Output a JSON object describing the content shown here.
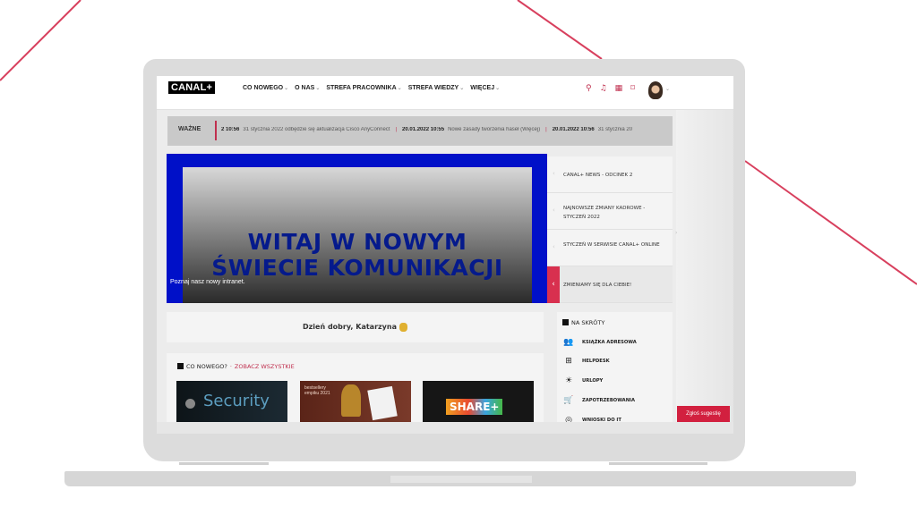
{
  "brand": {
    "logo_text": "CANAL+",
    "accent_color": "#d2203f",
    "hero_blue": "#0010c8"
  },
  "nav": {
    "items": [
      {
        "label": "CO NOWEGO",
        "has_dropdown": true
      },
      {
        "label": "O NAS",
        "has_dropdown": true
      },
      {
        "label": "STREFA PRACOWNIKA",
        "has_dropdown": true
      },
      {
        "label": "STREFA WIEDZY",
        "has_dropdown": true
      },
      {
        "label": "WIĘCEJ",
        "has_dropdown": true
      }
    ],
    "dropdown_glyph": "⌄"
  },
  "top_icons": [
    {
      "name": "search-icon",
      "glyph": "⚲"
    },
    {
      "name": "bell-icon",
      "glyph": "♫"
    },
    {
      "name": "apps-grid-icon",
      "glyph": "▦"
    },
    {
      "name": "bookmark-icon",
      "glyph": "⌑"
    }
  ],
  "user": {
    "avatar": "profile-photo",
    "menu_glyph": "⌄"
  },
  "important": {
    "label": "WAŻNE",
    "ticker": [
      {
        "date": "2 10:56",
        "text": "31 stycznia 2022 odbędzie się aktualizacja Cisco AnyConnect"
      },
      {
        "date": "20.01.2022 10:55",
        "text": "Nowe zasady tworzenia haseł (Więcej)"
      },
      {
        "date": "20.01.2022 10:56",
        "text": "31 stycznia 20"
      }
    ]
  },
  "hero": {
    "title_line1": "WITAJ W NOWYM",
    "title_line2": "ŚWIECIE KOMUNIKACJI",
    "caption": "Poznaj nasz nowy intranet."
  },
  "slider": {
    "items": [
      {
        "label": "CANAL+ NEWS - ODCINEK 2",
        "active": false
      },
      {
        "label": "NAJNOWSZE ZMIANY KADROWE - STYCZEŃ 2022",
        "active": false
      },
      {
        "label": "STYCZEŃ W SERWISIE CANAL+ ONLINE",
        "active": false
      },
      {
        "label": "ZMIENIAMY SIĘ DLA CIEBIE!",
        "active": true
      }
    ],
    "prev_glyph": "‹",
    "next_glyph": "›"
  },
  "greeting": {
    "text": "Dzień dobry, Katarzyna"
  },
  "news": {
    "heading": "CO NOWEGO?",
    "see_all": "ZOBACZ WSZYSTKIE",
    "thumbnails": [
      {
        "title": "Security"
      },
      {
        "title": "bestsellery empiku 2021"
      },
      {
        "title": "SHARE+"
      }
    ]
  },
  "shortcuts": {
    "heading": "NA SKRÓTY",
    "items": [
      {
        "label": "KSIĄŻKA ADRESOWA",
        "icon": "contacts-icon",
        "glyph": "👥"
      },
      {
        "label": "HELPDESK",
        "icon": "monitor-plus-icon",
        "glyph": "⊞"
      },
      {
        "label": "URLOPY",
        "icon": "sun-icon",
        "glyph": "☀"
      },
      {
        "label": "ZAPOTRZEBOWANIA",
        "icon": "cart-icon",
        "glyph": "🛒"
      },
      {
        "label": "WNIOSKI DO IT",
        "icon": "wifi-icon",
        "glyph": "◎"
      }
    ]
  },
  "suggest_button": {
    "label": "Zgłoś sugestię"
  }
}
